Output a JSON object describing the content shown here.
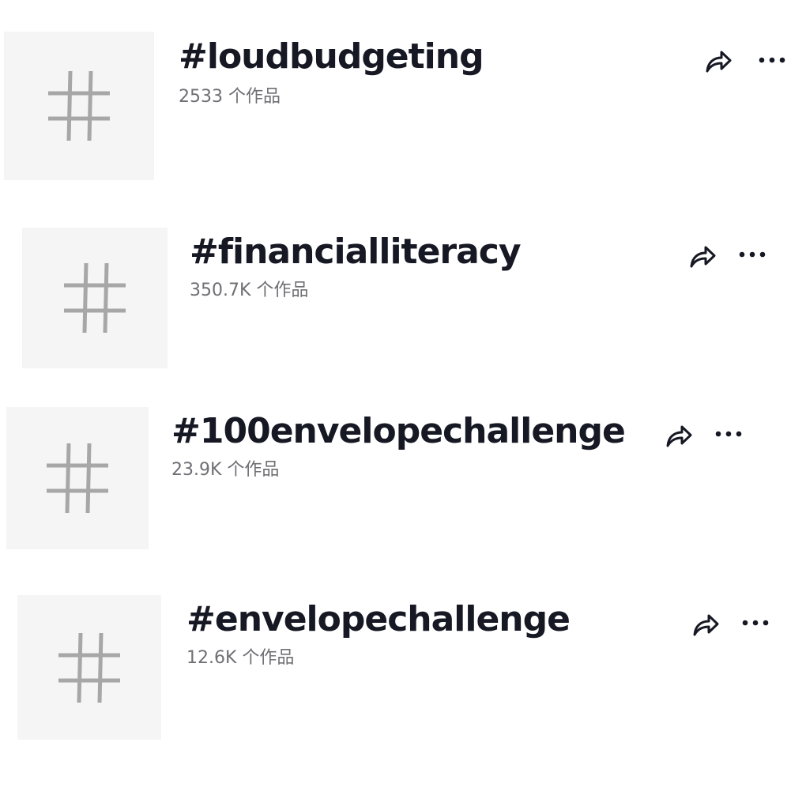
{
  "hashtags": [
    {
      "name": "#loudbudgeting",
      "count": "2533 个作品",
      "thumb_icon": "hashtag-icon"
    },
    {
      "name": "#financialliteracy",
      "count": "350.7K 个作品",
      "thumb_icon": "hashtag-icon"
    },
    {
      "name": "#100envelopechallenge",
      "count": "23.9K 个作品",
      "thumb_icon": "hashtag-icon"
    },
    {
      "name": "#envelopechallenge",
      "count": "12.6K 个作品",
      "thumb_icon": "hashtag-icon"
    }
  ],
  "icons": {
    "share": "share-icon",
    "more": "more-icon"
  },
  "colors": {
    "title": "#161823",
    "count": "#6f6f74",
    "thumb_bg": "#f5f5f5",
    "thumb_glyph": "#a7a7a7"
  }
}
